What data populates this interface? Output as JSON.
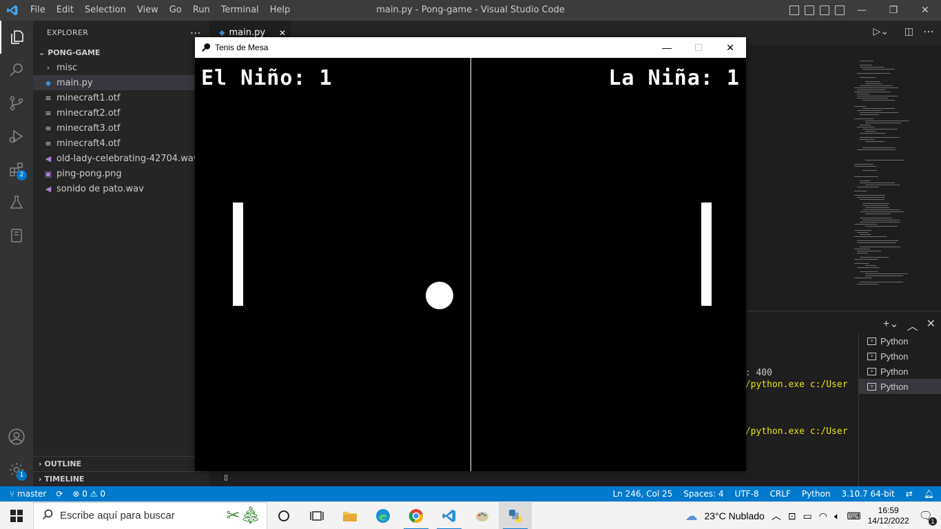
{
  "window_title": "main.py - Pong-game - Visual Studio Code",
  "menu": [
    "File",
    "Edit",
    "Selection",
    "View",
    "Go",
    "Run",
    "Terminal",
    "Help"
  ],
  "sidebar": {
    "header": "EXPLORER",
    "project": "PONG-GAME",
    "items": [
      {
        "label": "misc",
        "icon": "chevron-right-icon"
      },
      {
        "label": "main.py",
        "icon": "python-file-icon"
      },
      {
        "label": "minecraft1.otf",
        "icon": "font-file-icon"
      },
      {
        "label": "minecraft2.otf",
        "icon": "font-file-icon"
      },
      {
        "label": "minecraft3.otf",
        "icon": "font-file-icon"
      },
      {
        "label": "minecraft4.otf",
        "icon": "font-file-icon"
      },
      {
        "label": "old-lady-celebrating-42704.wav",
        "icon": "audio-file-icon"
      },
      {
        "label": "ping-pong.png",
        "icon": "image-file-icon"
      },
      {
        "label": "sonido de pato.wav",
        "icon": "audio-file-icon"
      }
    ],
    "outline": "OUTLINE",
    "timeline": "TIMELINE"
  },
  "activity_badges": {
    "extensions": "2",
    "settings": "1"
  },
  "editor_tab": "main.py",
  "terminal": {
    "line1": "r: 400",
    "line2": "0/python.exe c:/User",
    "line3": "0/python.exe c:/User",
    "instances": [
      "Python",
      "Python",
      "Python",
      "Python"
    ]
  },
  "statusbar": {
    "branch": "master",
    "errors": "0",
    "warnings": "0",
    "position": "Ln 246, Col 25",
    "spaces": "Spaces: 4",
    "encoding": "UTF-8",
    "eol": "CRLF",
    "language": "Python",
    "interpreter": "3.10.7 64-bit"
  },
  "game_window": {
    "title": "Tenis de Mesa",
    "score_left": "El Niño: 1",
    "score_right": "La Niña: 1"
  },
  "taskbar": {
    "search_placeholder": "Escribe aquí para buscar",
    "weather": "23°C  Nublado",
    "time": "16:59",
    "date": "14/12/2022",
    "notifications": "1"
  },
  "colors": {
    "accent": "#007acc",
    "game_bg": "#000000",
    "game_fg": "#ffffff"
  }
}
